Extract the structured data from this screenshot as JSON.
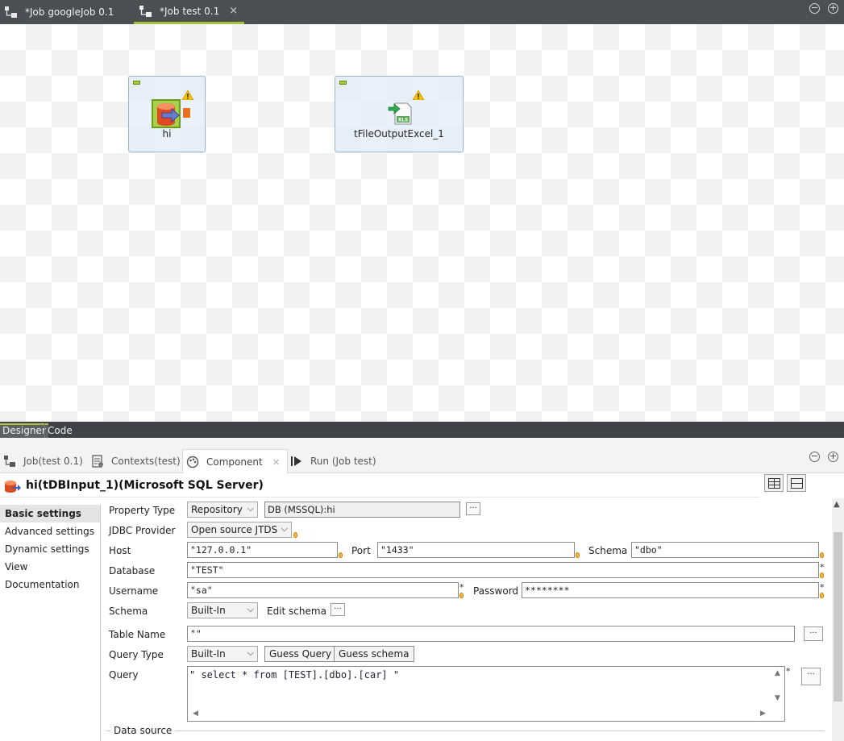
{
  "editor_tabs": [
    {
      "label": "*Job googleJob 0.1",
      "active": false
    },
    {
      "label": "*Job test 0.1",
      "active": true,
      "close": "×"
    }
  ],
  "window_controls": {
    "minimize": "−",
    "maximize": "+"
  },
  "canvas": {
    "components": [
      {
        "label": "hi",
        "icon": "mssql-input-icon",
        "warning": true
      },
      {
        "label": "tFileOutputExcel_1",
        "icon": "excel-output-icon",
        "warning": true,
        "excel_badge": "XLS"
      }
    ]
  },
  "view_tabs": [
    {
      "label": "Designer",
      "active": true
    },
    {
      "label": "Code",
      "active": false
    }
  ],
  "panel_tabs": [
    {
      "label": "Job(test 0.1)",
      "icon": "job-icon",
      "active": false
    },
    {
      "label": "Contexts(test)",
      "icon": "contexts-icon",
      "active": false
    },
    {
      "label": "Component",
      "icon": "component-palette-icon",
      "active": true,
      "close": "×"
    },
    {
      "label": "Run (Job test)",
      "icon": "run-icon",
      "active": false
    }
  ],
  "component": {
    "title": "hi(tDBInput_1)(Microsoft SQL Server)"
  },
  "nav": [
    {
      "label": "Basic settings",
      "active": true
    },
    {
      "label": "Advanced settings",
      "active": false
    },
    {
      "label": "Dynamic settings",
      "active": false
    },
    {
      "label": "View",
      "active": false
    },
    {
      "label": "Documentation",
      "active": false
    }
  ],
  "form": {
    "property_type": {
      "label": "Property Type",
      "value": "Repository",
      "repo_value": "DB (MSSQL):hi"
    },
    "jdbc_provider": {
      "label": "JDBC Provider",
      "value": "Open source JTDS"
    },
    "host": {
      "label": "Host",
      "value": "\"127.0.0.1\""
    },
    "port": {
      "label": "Port",
      "value": "\"1433\""
    },
    "schema_name": {
      "label": "Schema",
      "value": "\"dbo\""
    },
    "database": {
      "label": "Database",
      "value": "\"TEST\""
    },
    "username": {
      "label": "Username",
      "value": "\"sa\""
    },
    "password": {
      "label": "Password",
      "value": "********"
    },
    "schema": {
      "label": "Schema",
      "value": "Built-In",
      "edit_label": "Edit schema"
    },
    "table_name": {
      "label": "Table Name",
      "value": "\"\""
    },
    "query_type": {
      "label": "Query Type",
      "value": "Built-In",
      "guess_query": "Guess Query",
      "guess_schema": "Guess schema"
    },
    "query": {
      "label": "Query",
      "value": "\" select * from [TEST].[dbo].[car] \""
    },
    "data_source": {
      "label": "Data source"
    },
    "ellipsis": "...",
    "required_mark": "*"
  },
  "colors": {
    "accent": "#a8c23c",
    "tabbar_bg": "#4b4e52",
    "warning": "#f6c000"
  }
}
